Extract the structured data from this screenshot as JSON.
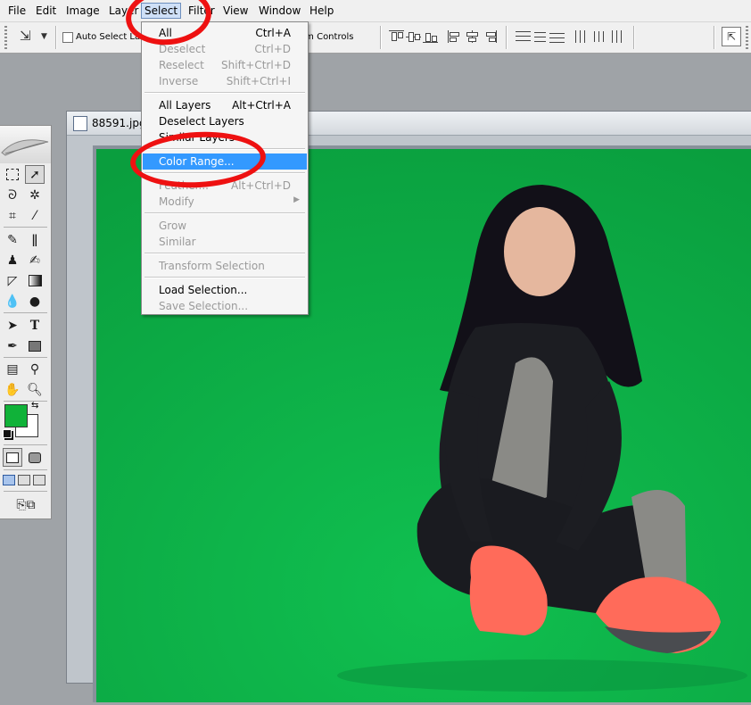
{
  "menubar": {
    "items": [
      "File",
      "Edit",
      "Image",
      "Layer",
      "Select",
      "Filter",
      "View",
      "Window",
      "Help"
    ]
  },
  "options_bar": {
    "auto_select_label": "Auto Select Layer",
    "transform_label": "Show Transform Controls"
  },
  "document": {
    "title": "88591.jpg"
  },
  "select_menu": {
    "items": [
      {
        "label": "All",
        "shortcut": "Ctrl+A",
        "enabled": true
      },
      {
        "label": "Deselect",
        "shortcut": "Ctrl+D",
        "enabled": false
      },
      {
        "label": "Reselect",
        "shortcut": "Shift+Ctrl+D",
        "enabled": false
      },
      {
        "label": "Inverse",
        "shortcut": "Shift+Ctrl+I",
        "enabled": false
      },
      {
        "label": "All Layers",
        "shortcut": "Alt+Ctrl+A",
        "enabled": true
      },
      {
        "label": "Deselect Layers",
        "shortcut": "",
        "enabled": true
      },
      {
        "label": "Similar Layers",
        "shortcut": "",
        "enabled": true
      },
      {
        "label": "Color Range...",
        "shortcut": "",
        "enabled": true,
        "highlighted": true
      },
      {
        "label": "Feather...",
        "shortcut": "Alt+Ctrl+D",
        "enabled": false
      },
      {
        "label": "Modify",
        "shortcut": "",
        "enabled": false,
        "submenu": true
      },
      {
        "label": "Grow",
        "shortcut": "",
        "enabled": false
      },
      {
        "label": "Similar",
        "shortcut": "",
        "enabled": false
      },
      {
        "label": "Transform Selection",
        "shortcut": "",
        "enabled": false
      },
      {
        "label": "Load Selection...",
        "shortcut": "",
        "enabled": true
      },
      {
        "label": "Save Selection...",
        "shortcut": "",
        "enabled": false
      }
    ]
  },
  "colors": {
    "foreground": "#10b239",
    "background": "#ffffff",
    "canvas_green": "#0dbd52",
    "menu_highlight": "#3399ff",
    "annotation_red": "#ee1111"
  },
  "icons": {
    "move_tool": "move-arrow",
    "marquee": "dashed-rectangle",
    "lasso": "lasso",
    "magic_wand": "magic-wand",
    "crop": "crop",
    "eyedropper": "eyedropper",
    "healing_brush": "bandage",
    "brush": "brush",
    "stamp": "stamp",
    "history_brush": "history-brush",
    "eraser": "eraser",
    "gradient": "gradient",
    "blur": "drop",
    "dodge": "dodge",
    "path_select": "arrow",
    "type": "T",
    "pen": "pen",
    "shape": "rectangle",
    "notes": "note",
    "hand": "hand",
    "zoom": "magnifier"
  }
}
